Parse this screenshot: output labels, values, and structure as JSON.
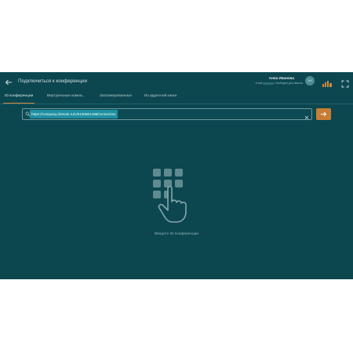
{
  "header": {
    "title": "Подключиться к конференции",
    "user_name": "Анна Иванова",
    "user_status_prefix": "email",
    "user_status_suffix": "Свободен для звонка",
    "avatar_initials": "АИ"
  },
  "tabs": [
    {
      "label": "ID конференции",
      "active": true
    },
    {
      "label": "Виртуальные комна...",
      "active": false
    },
    {
      "label": "Запланированные",
      "active": false
    },
    {
      "label": "Из адресной книги",
      "active": false
    }
  ],
  "search": {
    "value": "https://company.domain.ru/c/5130681498/connection"
  },
  "empty_state": {
    "caption": "Введите ID конференции"
  },
  "colors": {
    "background": "#0c4750",
    "accent": "#c77d35",
    "selection": "#1d8fa0"
  },
  "icons": {
    "back": "arrow-left-icon",
    "fullscreen": "fullscreen-icon",
    "logo": "bars-logo-icon",
    "search": "search-icon",
    "clear": "close-icon",
    "go": "arrow-right-icon",
    "illustration": "keypad-hand-icon"
  }
}
